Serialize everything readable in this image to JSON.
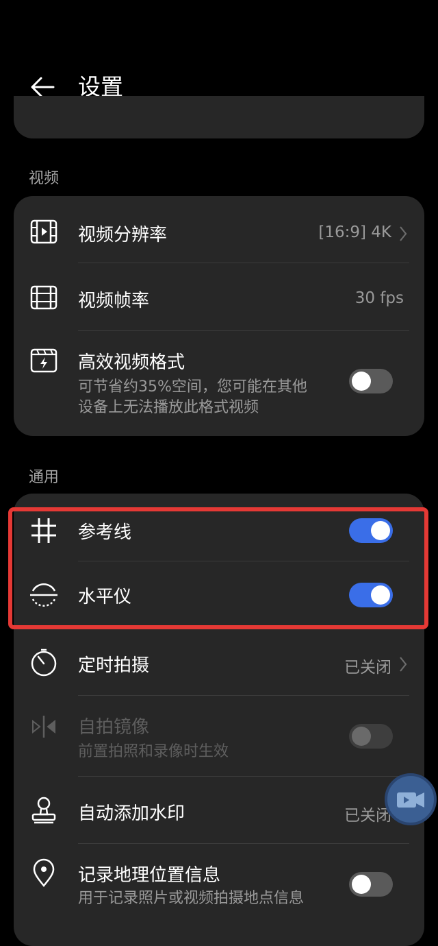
{
  "header": {
    "title": "设置",
    "back_icon": "arrow-left-icon"
  },
  "sections": {
    "video": "视频",
    "general": "通用"
  },
  "video_rows": [
    {
      "label": "视频分辨率",
      "value": "[16:9] 4K",
      "icon": "film-play-icon"
    },
    {
      "label": "视频帧率",
      "value": "30 fps",
      "icon": "film-strip-icon"
    },
    {
      "label": "高效视频格式",
      "subtitle_line1": "可节省约35%空间，您可能在其他",
      "subtitle_line2": "设备上无法播放此格式视频",
      "toggle": false,
      "icon": "clapper-bolt-icon"
    }
  ],
  "general_rows": [
    {
      "label": "参考线",
      "toggle": true,
      "icon": "grid-icon"
    },
    {
      "label": "水平仪",
      "toggle": true,
      "icon": "level-icon"
    },
    {
      "label": "定时拍摄",
      "value": "已关闭",
      "icon": "timer-icon"
    },
    {
      "label": "自拍镜像",
      "subtitle": "前置拍照和录像时生效",
      "toggle": false,
      "disabled": true,
      "icon": "mirror-icon"
    },
    {
      "label": "自动添加水印",
      "value": "已关闭",
      "icon": "stamp-icon"
    },
    {
      "label": "记录地理位置信息",
      "subtitle": "用于记录照片或视频拍摄地点信息",
      "toggle": false,
      "icon": "location-pin-icon"
    }
  ],
  "colors": {
    "accent": "#3a6ee8",
    "highlight": "#e53935",
    "card": "#272727",
    "background": "#000000"
  }
}
